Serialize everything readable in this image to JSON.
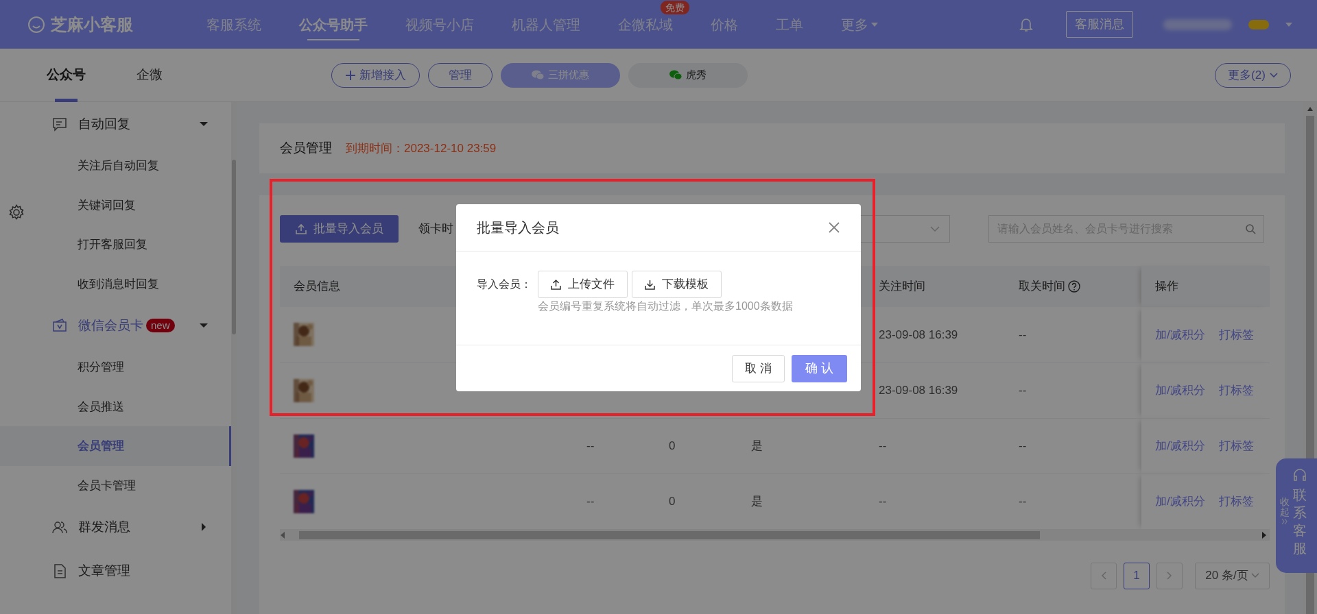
{
  "header": {
    "logo": "芝麻小客服",
    "nav": [
      {
        "label": "客服系统",
        "selected": false
      },
      {
        "label": "公众号助手",
        "selected": true
      },
      {
        "label": "视频号小店",
        "selected": false
      },
      {
        "label": "机器人管理",
        "selected": false
      },
      {
        "label": "企微私域",
        "selected": false,
        "badge": "免费"
      },
      {
        "label": "价格",
        "selected": false
      },
      {
        "label": "工单",
        "selected": false
      },
      {
        "label": "更多",
        "selected": false,
        "dropdown": true
      }
    ],
    "message_button": "客服消息"
  },
  "subnav": {
    "tabs": [
      {
        "label": "公众号",
        "selected": true
      },
      {
        "label": "企微",
        "selected": false
      }
    ],
    "actions": [
      {
        "label": "新增接入",
        "kind": "add"
      },
      {
        "label": "管理",
        "kind": "plain"
      }
    ],
    "accounts": [
      {
        "label": "三拼优惠",
        "selected": true
      },
      {
        "label": "虎秀",
        "selected": false
      }
    ],
    "more": "更多(2)"
  },
  "sidebar": {
    "items": [
      {
        "label": "自动回复",
        "expanded": true,
        "children": [
          {
            "label": "关注后自动回复",
            "selected": false
          },
          {
            "label": "关键词回复",
            "selected": false
          },
          {
            "label": "打开客服回复",
            "selected": false
          },
          {
            "label": "收到消息时回复",
            "selected": false
          }
        ]
      },
      {
        "label": "微信会员卡",
        "badge": "new",
        "expanded": true,
        "children": [
          {
            "label": "积分管理",
            "selected": false
          },
          {
            "label": "会员推送",
            "selected": false
          },
          {
            "label": "会员管理",
            "selected": true
          },
          {
            "label": "会员卡管理",
            "selected": false
          }
        ]
      },
      {
        "label": "群发消息",
        "expanded": false
      },
      {
        "label": "文章管理"
      }
    ]
  },
  "page_header": {
    "title": "会员管理",
    "expiry": "到期时间：2023-12-10 23:59"
  },
  "toolbar": {
    "import_button": "批量导入会员",
    "filter_label": "领卡时",
    "search_placeholder": "请输入会员姓名、会员卡号进行搜索"
  },
  "table": {
    "columns": [
      {
        "label": "会员信息"
      },
      {},
      {},
      {},
      {},
      {
        "label": "关注时间"
      },
      {
        "label": "取关时间",
        "help": true
      },
      {
        "label": "操作"
      }
    ],
    "rows": [
      {
        "member": {
          "kind": "picture"
        },
        "cells": [
          "",
          "",
          "",
          "",
          "",
          "23-09-08 16:39",
          "--"
        ],
        "actions": [
          "加/减积分",
          "打标签"
        ]
      },
      {
        "member": {
          "kind": "picture"
        },
        "cells": [
          "",
          "",
          "",
          "",
          "",
          "23-09-08 16:39",
          "--"
        ],
        "actions": [
          "加/减积分",
          "打标签"
        ]
      },
      {
        "member": {
          "kind": "picture"
        },
        "cells": [
          "",
          "",
          "--",
          "0",
          "是",
          "--",
          "--"
        ],
        "actions": [
          "加/减积分",
          "打标签"
        ]
      },
      {
        "member": {
          "kind": "picture"
        },
        "cells": [
          "",
          "",
          "--",
          "0",
          "是",
          "--",
          "--"
        ],
        "actions": [
          "加/减积分",
          "打标签"
        ]
      }
    ]
  },
  "pagination": {
    "pages": [
      {
        "label": "1",
        "selected": true
      }
    ],
    "page_size": "20 条/页"
  },
  "modal": {
    "title": "批量导入会员",
    "field_label": "导入会员：",
    "upload_button": "上传文件",
    "download_button": "下载模板",
    "hint": "会员编号重复系统将自动过滤，单次最多1000条数据",
    "cancel": "取 消",
    "confirm": "确 认"
  },
  "float_tab": {
    "collapse": "收起",
    "contact": "联系客服"
  },
  "annotation": {
    "kind": "frame"
  }
}
